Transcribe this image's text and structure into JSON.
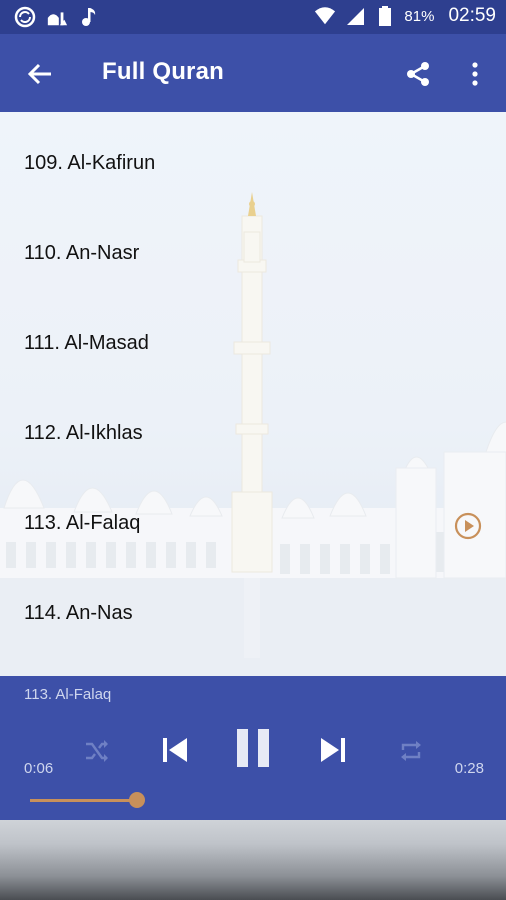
{
  "status_bar": {
    "battery_percent": "81%",
    "time": "02:59"
  },
  "app_bar": {
    "title": "Full Quran"
  },
  "list": {
    "items": [
      {
        "label": "109. Al-Kafirun"
      },
      {
        "label": "110. An-Nasr"
      },
      {
        "label": "111. Al-Masad"
      },
      {
        "label": "112. Al-Ikhlas"
      },
      {
        "label": "113. Al-Falaq"
      },
      {
        "label": "114. An-Nas"
      }
    ],
    "playing_index": 4
  },
  "player": {
    "now_playing": "113. Al-Falaq",
    "elapsed": "0:06",
    "duration": "0:28",
    "progress": 0.24
  },
  "colors": {
    "status_bar": "#2e3f8f",
    "primary": "#3d50a8",
    "accent": "#c8905a"
  }
}
